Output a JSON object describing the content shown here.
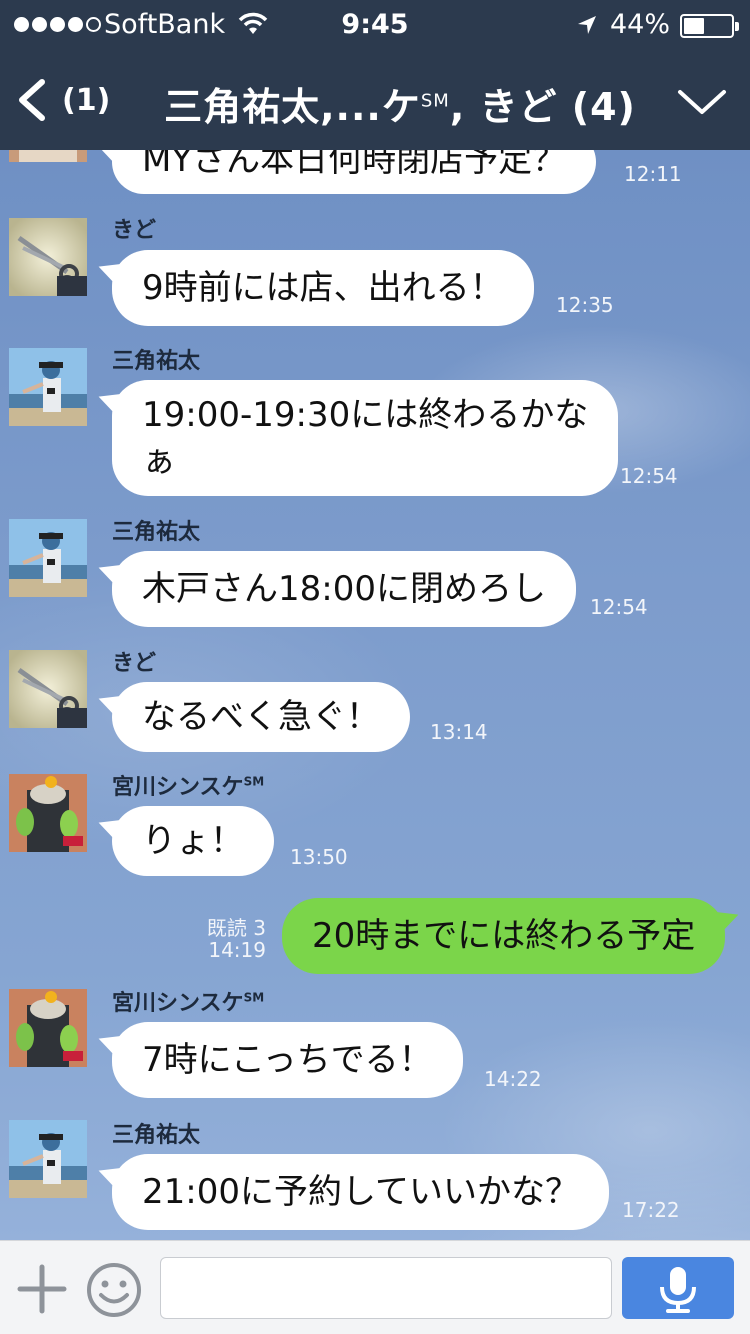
{
  "status_bar": {
    "carrier": "SoftBank",
    "time": "9:45",
    "battery_percent_label": "44%",
    "battery_level": 0.44
  },
  "nav": {
    "back_count": "(1)",
    "title": "三角祐太,...ケ",
    "title_sm": "SM",
    "title_tail": ", きど (4)"
  },
  "messages": [
    {
      "type": "incoming",
      "sender": "",
      "text": "MYさん本日何時閉店予定？",
      "time": "12:11",
      "avatar": "bald-hat-photo"
    },
    {
      "type": "incoming",
      "sender": "きど",
      "text": "9時前には店、出れる！",
      "time": "12:35",
      "avatar": "scissors-photo"
    },
    {
      "type": "incoming",
      "sender": "三角祐太",
      "text_line1": "19:00-19:30には終わるかな",
      "text_line2": "ぁ",
      "time": "12:54",
      "avatar": "beach-person-photo"
    },
    {
      "type": "incoming",
      "sender": "三角祐太",
      "text": "木戸さん18:00に閉めろし",
      "time": "12:54",
      "avatar": "beach-person-photo"
    },
    {
      "type": "incoming",
      "sender": "きど",
      "text": "なるべく急ぐ！",
      "time": "13:14",
      "avatar": "scissors-photo"
    },
    {
      "type": "incoming",
      "sender": "宮川シンスケ",
      "sender_sm": "SM",
      "text": "りょ！",
      "time": "13:50",
      "avatar": "parrots-photo"
    },
    {
      "type": "outgoing",
      "read": "既読 3",
      "text": "20時までには終わる予定",
      "time": "14:19"
    },
    {
      "type": "incoming",
      "sender": "宮川シンスケ",
      "sender_sm": "SM",
      "text": "7時にこっちでる！",
      "time": "14:22",
      "avatar": "parrots-photo"
    },
    {
      "type": "incoming",
      "sender": "三角祐太",
      "text": "21:00に予約していいかな？",
      "time": "17:22",
      "avatar": "beach-person-photo"
    }
  ],
  "input_bar": {
    "placeholder": "",
    "icons": [
      "plus-icon",
      "emoji-icon",
      "microphone-icon"
    ]
  },
  "colors": {
    "header": "#2c3a4e",
    "outgoing_bubble": "#7bd54a",
    "incoming_bubble": "#ffffff",
    "send_button": "#4a86e0"
  }
}
